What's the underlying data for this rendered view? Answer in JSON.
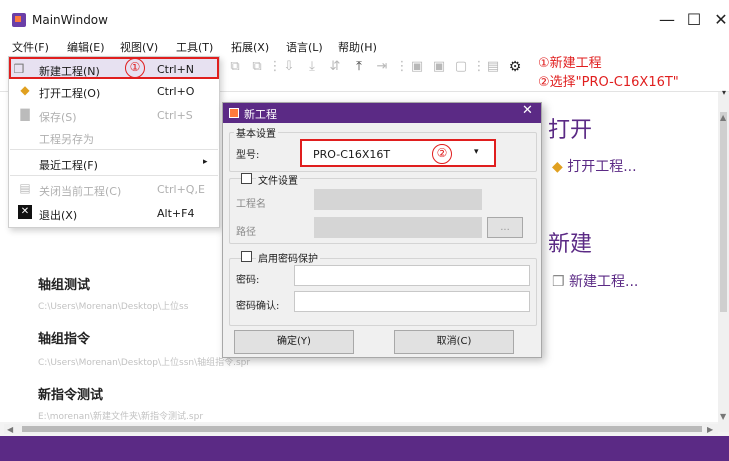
{
  "window": {
    "title": "MainWindow",
    "minimize": "—",
    "maximize": "☐",
    "close": "✕"
  },
  "menubar": {
    "items": [
      {
        "label": "文件(F)"
      },
      {
        "label": "编辑(E)"
      },
      {
        "label": "视图(V)"
      },
      {
        "label": "工具(T)"
      },
      {
        "label": "拓展(X)"
      },
      {
        "label": "语言(L)"
      },
      {
        "label": "帮助(H)"
      }
    ]
  },
  "annotations": {
    "line1": "①新建工程",
    "line2": "②选择\"PRO-C16X16T\"",
    "marker1": "①",
    "marker2": "②"
  },
  "file_menu": {
    "items": [
      {
        "label": "新建工程(N)",
        "shortcut": "Ctrl+N",
        "icon": "new-project-icon"
      },
      {
        "label": "打开工程(O)",
        "shortcut": "Ctrl+O",
        "icon": "open-folder-icon"
      },
      {
        "label": "保存(S)",
        "shortcut": "Ctrl+S",
        "icon": "save-icon"
      },
      {
        "label": "工程另存为",
        "shortcut": ""
      },
      {
        "label": "最近工程(F)",
        "shortcut": "▸"
      },
      {
        "label": "关闭当前工程(C)",
        "shortcut": "Ctrl+Q,E",
        "icon": "close-project-icon"
      },
      {
        "label": "退出(X)",
        "shortcut": "Alt+F4",
        "icon": "exit-icon"
      }
    ]
  },
  "right_panel": {
    "open_title": "打开",
    "open_link": "打开工程...",
    "new_title": "新建",
    "new_link": "新建工程..."
  },
  "recent": [
    {
      "title": "轴组测试",
      "path": "C:\\Users\\Morenan\\Desktop\\上位ss"
    },
    {
      "title": "轴组指令",
      "path": "C:\\Users\\Morenan\\Desktop\\上位ssn\\轴组指令.spr"
    },
    {
      "title": "新指令测试",
      "path": "E:\\morenan\\新建文件夹\\新指令测试.spr"
    }
  ],
  "dialog": {
    "title": "新工程",
    "basic_group": "基本设置",
    "model_label": "型号:",
    "model_value": "PRO-C16X16T",
    "file_group": "文件设置",
    "project_name_label": "工程名",
    "path_label": "路径",
    "browse_label": "...",
    "password_group": "启用密码保护",
    "password_label": "密码:",
    "password_confirm_label": "密码确认:",
    "ok_label": "确定(Y)",
    "cancel_label": "取消(C)"
  },
  "colors": {
    "accent": "#5b2a85",
    "annotation": "#e01e1e"
  }
}
